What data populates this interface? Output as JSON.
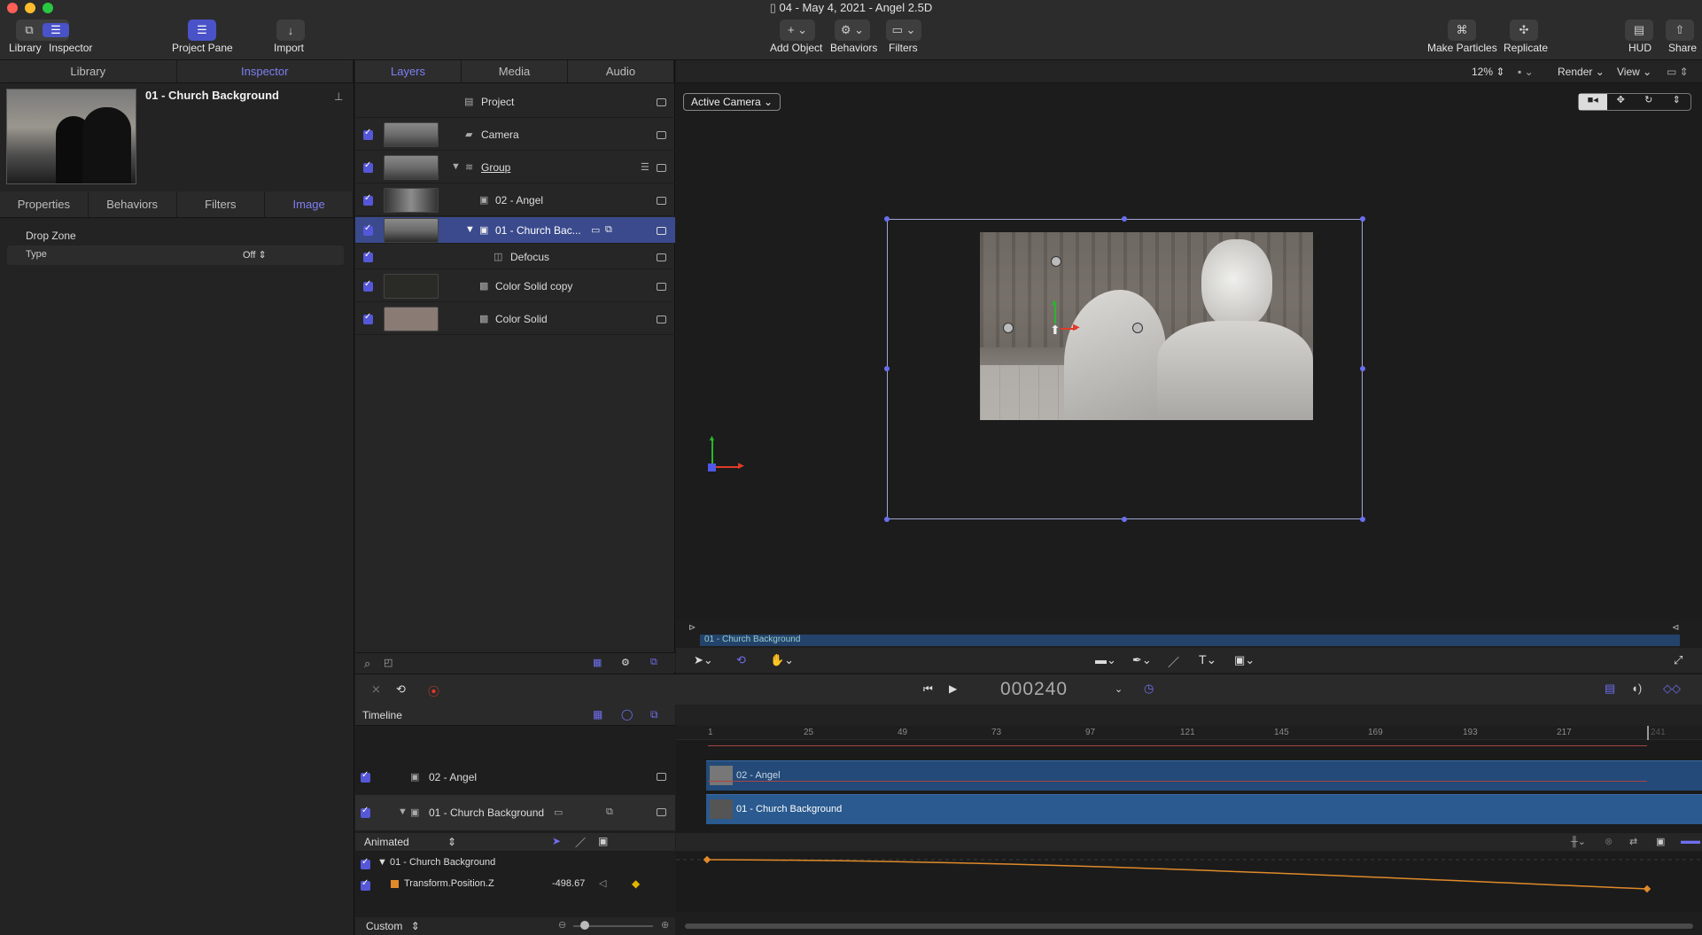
{
  "window": {
    "title": "04 - May 4, 2021 - Angel 2.5D"
  },
  "toolbar": {
    "library": "Library",
    "inspector": "Inspector",
    "project_pane": "Project Pane",
    "import": "Import",
    "add_object": "Add Object",
    "behaviors": "Behaviors",
    "filters": "Filters",
    "make_particles": "Make Particles",
    "replicate": "Replicate",
    "hud": "HUD",
    "share": "Share"
  },
  "left_tabs": {
    "library": "Library",
    "inspector": "Inspector"
  },
  "inspector": {
    "title": "01 - Church Background",
    "tabs": [
      "Properties",
      "Behaviors",
      "Filters",
      "Image"
    ],
    "drop_zone": "Drop Zone",
    "type_label": "Type",
    "type_value": "Off"
  },
  "layers_tabs": {
    "layers": "Layers",
    "media": "Media",
    "audio": "Audio"
  },
  "layers": {
    "project": "Project",
    "camera": "Camera",
    "group": "Group",
    "angel": "02 - Angel",
    "church": "01 - Church Bac...",
    "defocus": "Defocus",
    "color_solid_copy": "Color Solid copy",
    "color_solid": "Color Solid"
  },
  "viewer": {
    "zoom": "12%",
    "render": "Render",
    "view": "View",
    "camera_select": "Active Camera",
    "mini_bar_label": "01 - Church Background"
  },
  "transport": {
    "timecode": "000240"
  },
  "timeline": {
    "label": "Timeline",
    "ruler": [
      "1",
      "25",
      "49",
      "73",
      "97",
      "121",
      "145",
      "169",
      "193",
      "217",
      "241"
    ],
    "track_angel": "02 - Angel",
    "track_church": "01 - Church Background",
    "clip_angel": "02 - Angel",
    "clip_church": "01 - Church Background"
  },
  "keyframes": {
    "filter": "Animated",
    "group": "01 - Church Background",
    "param": "Transform.Position.Z",
    "value": "-498.67",
    "bottom_select": "Custom"
  },
  "colors": {
    "accent": "#5557d8",
    "selection": "#3a4a8c",
    "clip": "#234a78",
    "curve": "#e08a2a"
  }
}
